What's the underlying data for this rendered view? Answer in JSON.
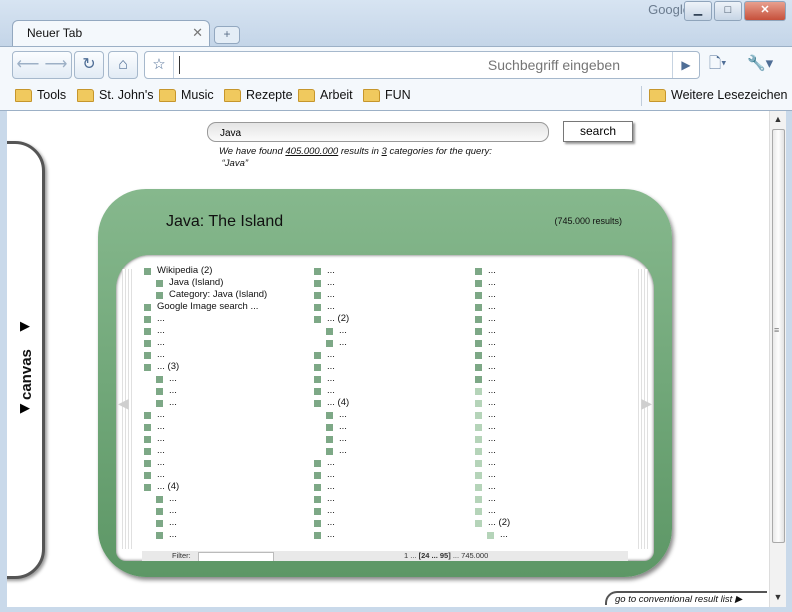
{
  "browser": {
    "brand": "Google",
    "tab_title": "Neuer Tab",
    "omnibox_placeholder": "Suchbegriff eingeben",
    "window_buttons": {
      "minimize": "▁",
      "maximize": "□",
      "close": "✕"
    },
    "bookmarks": [
      "Tools",
      "St. John's",
      "Music",
      "Rezepte",
      "Arbeit",
      "FUN"
    ],
    "other_bookmarks": "Weitere Lesezeichen"
  },
  "page": {
    "query_value": "Java",
    "search_label": "search",
    "found": {
      "prefix": "We have found",
      "count": "405.000.000",
      "middle": "results in",
      "categories": "3",
      "suffix": "categories for the query:",
      "query": "“Java”"
    },
    "canvas_label": "canvas",
    "card": {
      "title": "Java: The Island",
      "results": "(745.000 results)",
      "columns": [
        [
          {
            "t": "Wikipedia (2)",
            "i": 0,
            "c": "d"
          },
          {
            "t": "Java (Island)",
            "i": 1,
            "c": "d"
          },
          {
            "t": "Category: Java (Island)",
            "i": 1,
            "c": "d"
          },
          {
            "t": "Google Image search ...",
            "i": 0,
            "c": "d"
          },
          {
            "t": "...",
            "i": 0,
            "c": "d"
          },
          {
            "t": "...",
            "i": 0,
            "c": "d"
          },
          {
            "t": "...",
            "i": 0,
            "c": "d"
          },
          {
            "t": "...",
            "i": 0,
            "c": "d"
          },
          {
            "t": "... (3)",
            "i": 0,
            "c": "d"
          },
          {
            "t": "...",
            "i": 1,
            "c": "d"
          },
          {
            "t": "...",
            "i": 1,
            "c": "d"
          },
          {
            "t": "...",
            "i": 1,
            "c": "d"
          },
          {
            "t": "...",
            "i": 0,
            "c": "d"
          },
          {
            "t": "...",
            "i": 0,
            "c": "d"
          },
          {
            "t": "...",
            "i": 0,
            "c": "d"
          },
          {
            "t": "...",
            "i": 0,
            "c": "d"
          },
          {
            "t": "...",
            "i": 0,
            "c": "d"
          },
          {
            "t": "...",
            "i": 0,
            "c": "d"
          },
          {
            "t": "... (4)",
            "i": 0,
            "c": "d"
          },
          {
            "t": "...",
            "i": 1,
            "c": "d"
          },
          {
            "t": "...",
            "i": 1,
            "c": "d"
          },
          {
            "t": "...",
            "i": 1,
            "c": "d"
          },
          {
            "t": "...",
            "i": 1,
            "c": "d"
          }
        ],
        [
          {
            "t": "...",
            "i": 0,
            "c": "d"
          },
          {
            "t": "...",
            "i": 0,
            "c": "d"
          },
          {
            "t": "...",
            "i": 0,
            "c": "d"
          },
          {
            "t": "...",
            "i": 0,
            "c": "d"
          },
          {
            "t": "... (2)",
            "i": 0,
            "c": "d"
          },
          {
            "t": "...",
            "i": 1,
            "c": "d"
          },
          {
            "t": "...",
            "i": 1,
            "c": "d"
          },
          {
            "t": "...",
            "i": 0,
            "c": "d"
          },
          {
            "t": "...",
            "i": 0,
            "c": "d"
          },
          {
            "t": "...",
            "i": 0,
            "c": "d"
          },
          {
            "t": "...",
            "i": 0,
            "c": "d"
          },
          {
            "t": "... (4)",
            "i": 0,
            "c": "d"
          },
          {
            "t": "...",
            "i": 1,
            "c": "d"
          },
          {
            "t": "...",
            "i": 1,
            "c": "d"
          },
          {
            "t": "...",
            "i": 1,
            "c": "d"
          },
          {
            "t": "...",
            "i": 1,
            "c": "d"
          },
          {
            "t": "...",
            "i": 0,
            "c": "d"
          },
          {
            "t": "...",
            "i": 0,
            "c": "d"
          },
          {
            "t": "...",
            "i": 0,
            "c": "d"
          },
          {
            "t": "...",
            "i": 0,
            "c": "d"
          },
          {
            "t": "...",
            "i": 0,
            "c": "d"
          },
          {
            "t": "...",
            "i": 0,
            "c": "d"
          },
          {
            "t": "...",
            "i": 0,
            "c": "d"
          }
        ],
        [
          {
            "t": "...",
            "i": 0,
            "c": "d"
          },
          {
            "t": "...",
            "i": 0,
            "c": "d"
          },
          {
            "t": "...",
            "i": 0,
            "c": "d"
          },
          {
            "t": "...",
            "i": 0,
            "c": "d"
          },
          {
            "t": "...",
            "i": 0,
            "c": "d"
          },
          {
            "t": "...",
            "i": 0,
            "c": "d"
          },
          {
            "t": "...",
            "i": 0,
            "c": "d"
          },
          {
            "t": "...",
            "i": 0,
            "c": "d"
          },
          {
            "t": "...",
            "i": 0,
            "c": "d"
          },
          {
            "t": "...",
            "i": 0,
            "c": "d"
          },
          {
            "t": "...",
            "i": 0,
            "c": "l"
          },
          {
            "t": "...",
            "i": 0,
            "c": "l"
          },
          {
            "t": "...",
            "i": 0,
            "c": "l"
          },
          {
            "t": "...",
            "i": 0,
            "c": "l"
          },
          {
            "t": "...",
            "i": 0,
            "c": "l"
          },
          {
            "t": "...",
            "i": 0,
            "c": "l"
          },
          {
            "t": "...",
            "i": 0,
            "c": "l"
          },
          {
            "t": "...",
            "i": 0,
            "c": "l"
          },
          {
            "t": "...",
            "i": 0,
            "c": "l"
          },
          {
            "t": "...",
            "i": 0,
            "c": "l"
          },
          {
            "t": "...",
            "i": 0,
            "c": "l"
          },
          {
            "t": "... (2)",
            "i": 0,
            "c": "l"
          },
          {
            "t": "...",
            "i": 1,
            "c": "l"
          }
        ]
      ]
    },
    "filter_label": "Filter:",
    "pager": {
      "start": "1 ...",
      "current": "[24 ... 95]",
      "end": "... 745.000"
    },
    "conventional_link": "go to conventional result list ▶"
  }
}
